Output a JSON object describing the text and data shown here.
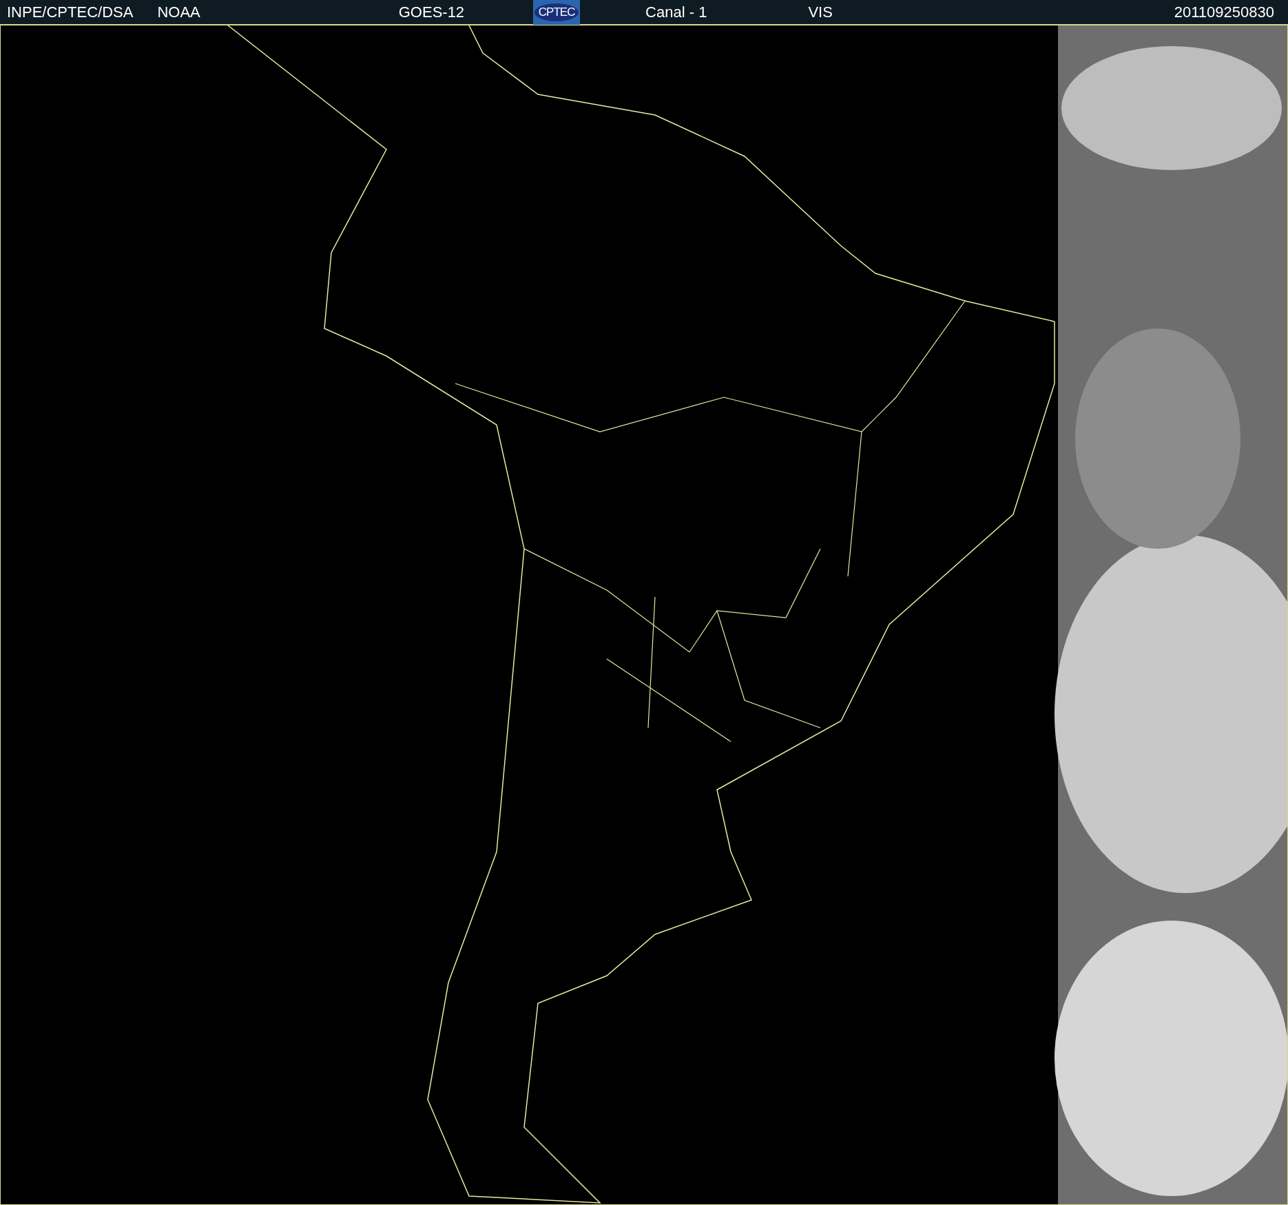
{
  "header": {
    "agency": "INPE/CPTEC/DSA",
    "source": "NOAA",
    "satellite": "GOES-12",
    "logo": "CPTEC",
    "channel": "Canal - 1",
    "band": "VIS",
    "timestamp": "201109250830"
  }
}
